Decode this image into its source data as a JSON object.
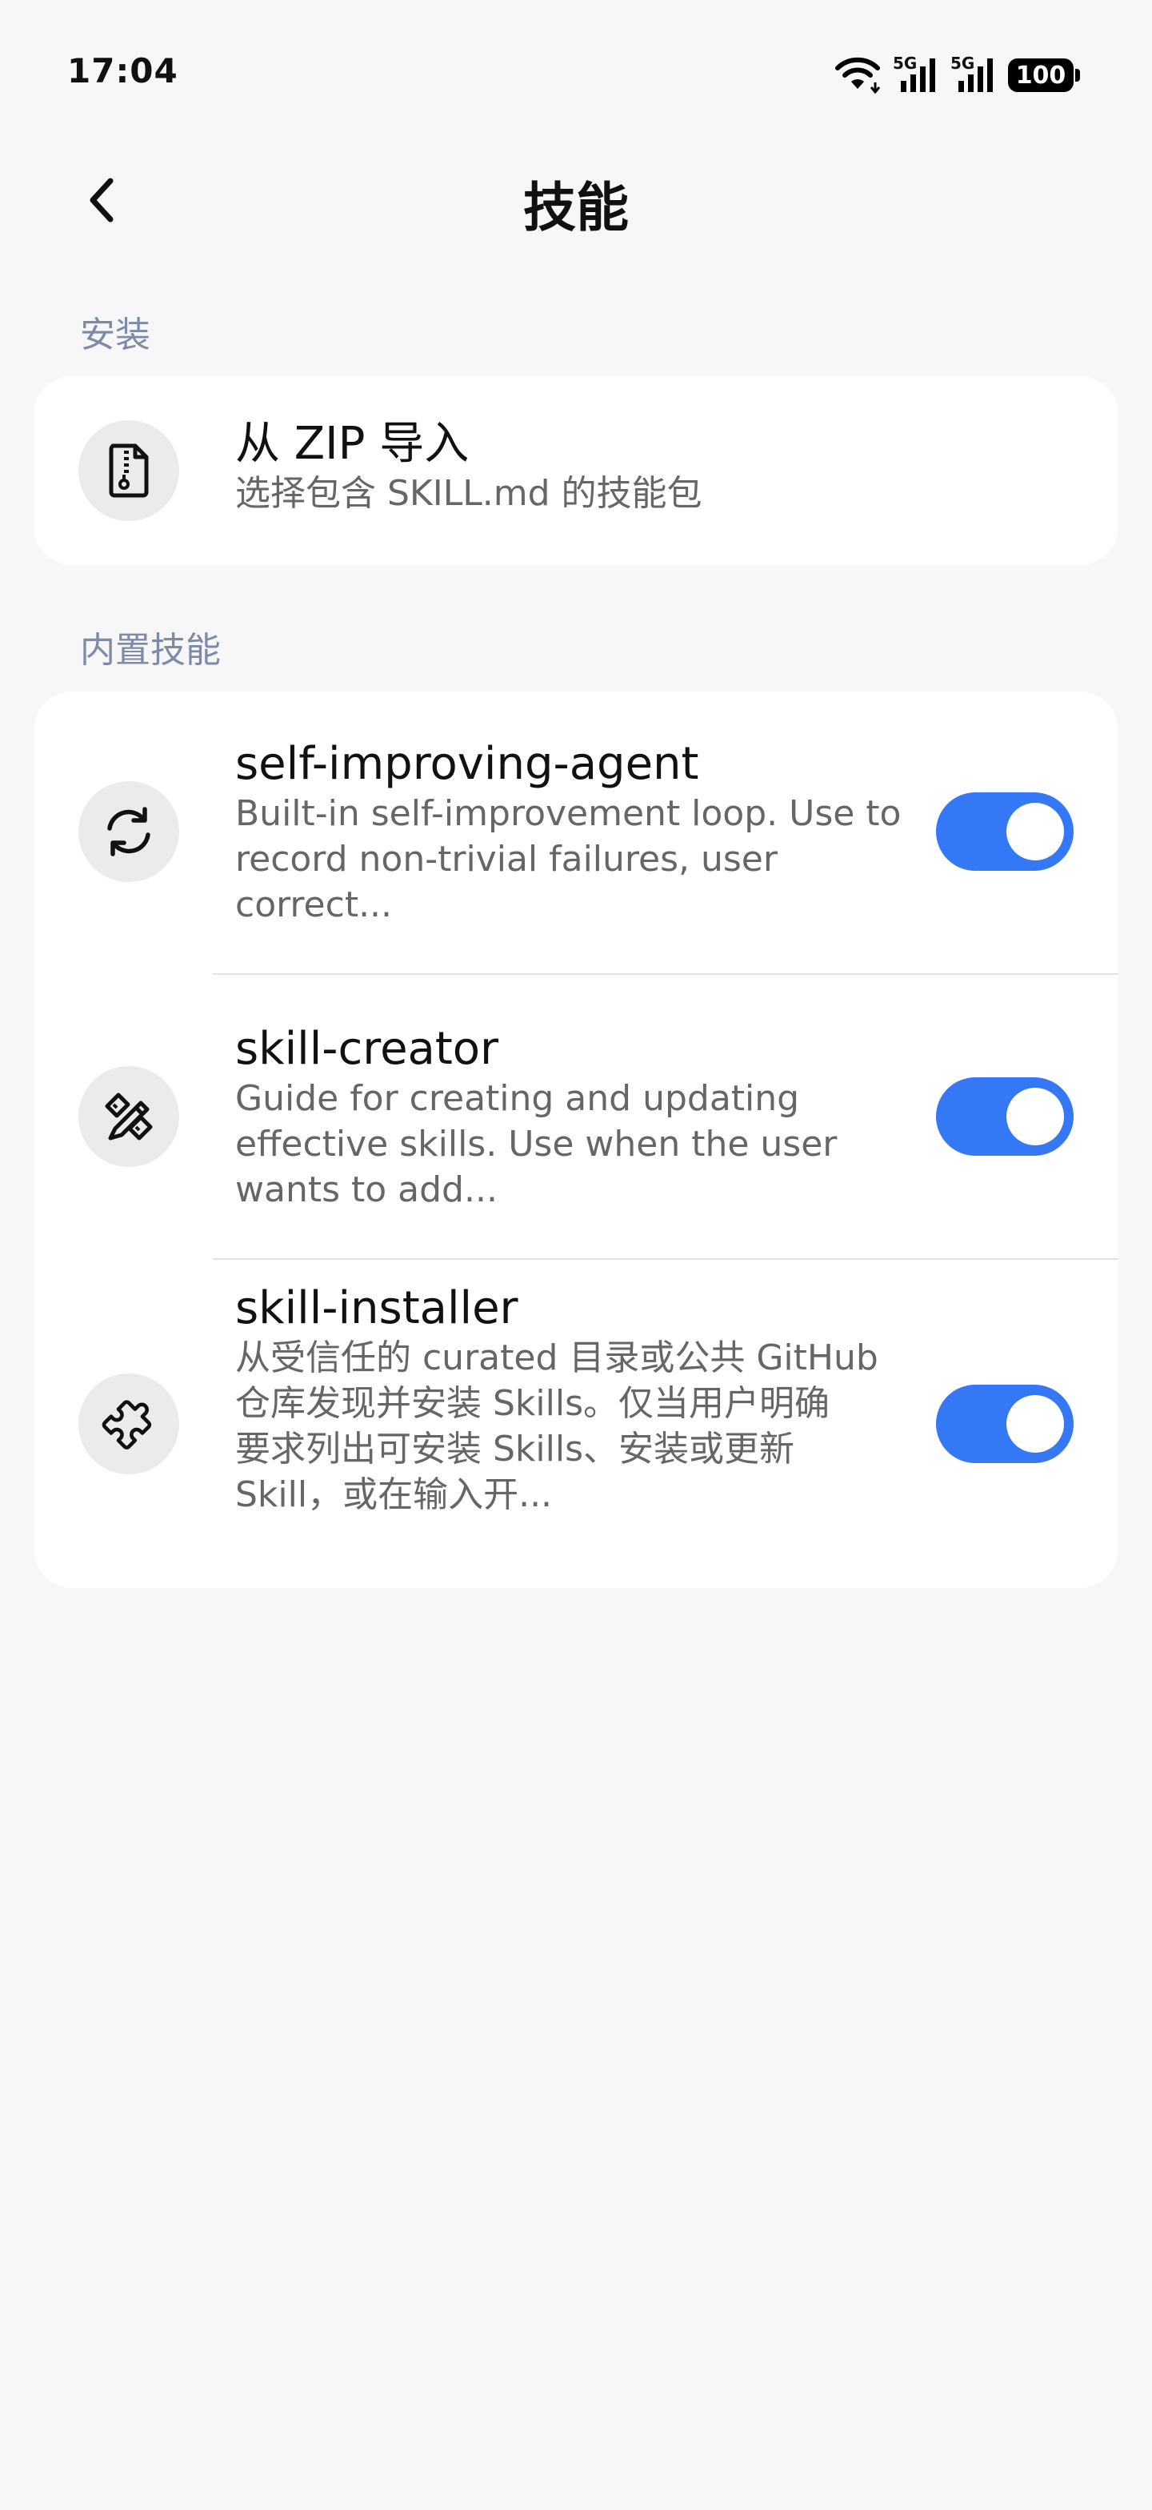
{
  "status_bar": {
    "time": "17:04",
    "network_1": "5G",
    "network_2": "5G",
    "battery": "100",
    "icons": [
      "wifi-icon",
      "signal-icon",
      "signal-icon",
      "battery-icon"
    ]
  },
  "nav": {
    "title": "技能",
    "back_icon": "chevron-left-icon"
  },
  "install_section": {
    "label": "安装",
    "items": [
      {
        "title": "从 ZIP 导入",
        "description": "选择包含 SKILL.md 的技能包",
        "icon": "zip-file-icon"
      }
    ]
  },
  "builtin_section": {
    "label": "内置技能",
    "items": [
      {
        "title": "self-improving-agent",
        "description_lines": [
          "Built-in self-improvement loop. Use to",
          "record non-trivial failures, user",
          "correct..."
        ],
        "icon": "refresh-icon",
        "enabled": true
      },
      {
        "title": "skill-creator",
        "description_lines": [
          "Guide for creating and updating",
          "effective skills. Use when the user",
          "wants to add..."
        ],
        "icon": "pencil-ruler-icon",
        "enabled": true
      },
      {
        "title": "skill-installer",
        "description_lines": [
          "从受信任的 curated 目录或公共 GitHub",
          "仓库发现并安装 Skills。仅当用户明确",
          "要求列出可安装 Skills、安装或更新",
          "Skill，或在输入开..."
        ],
        "icon": "puzzle-icon",
        "enabled": true
      }
    ]
  },
  "colors": {
    "accent": "#3478f6",
    "background": "#f7f7f7",
    "card": "#ffffff",
    "section_label": "#7e8aa8",
    "secondary_text": "#666666"
  }
}
